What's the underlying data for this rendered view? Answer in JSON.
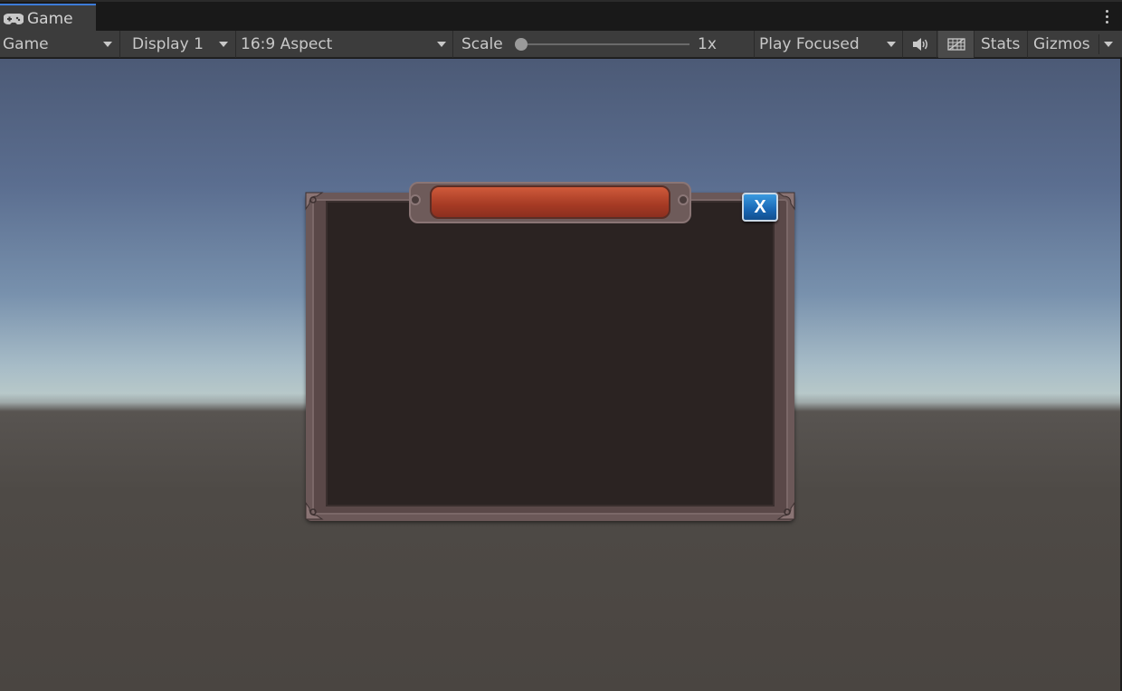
{
  "tab": {
    "icon": "gamepad-icon",
    "label": "Game"
  },
  "toolbar": {
    "view_select": "Game",
    "display_select": "Display 1",
    "aspect_select": "16:9 Aspect",
    "scale_label": "Scale",
    "scale_value_label": "1x",
    "scale_fraction": 0.0,
    "play_mode_select": "Play Focused",
    "audio_icon": "speaker-icon",
    "gizmo_grid_icon": "grid-toggle-icon",
    "stats_label": "Stats",
    "gizmos_label": "Gizmos"
  },
  "viewport": {
    "dialog": {
      "title": "",
      "close_label": "X",
      "close_color": "#1967b4",
      "title_bar_color": "#b8432b"
    }
  },
  "colors": {
    "accent": "#3d7bd8",
    "toolbar_bg": "#3c3c3c",
    "tab_bg": "#3c3c3c",
    "panel_inner": "#2b2322"
  }
}
